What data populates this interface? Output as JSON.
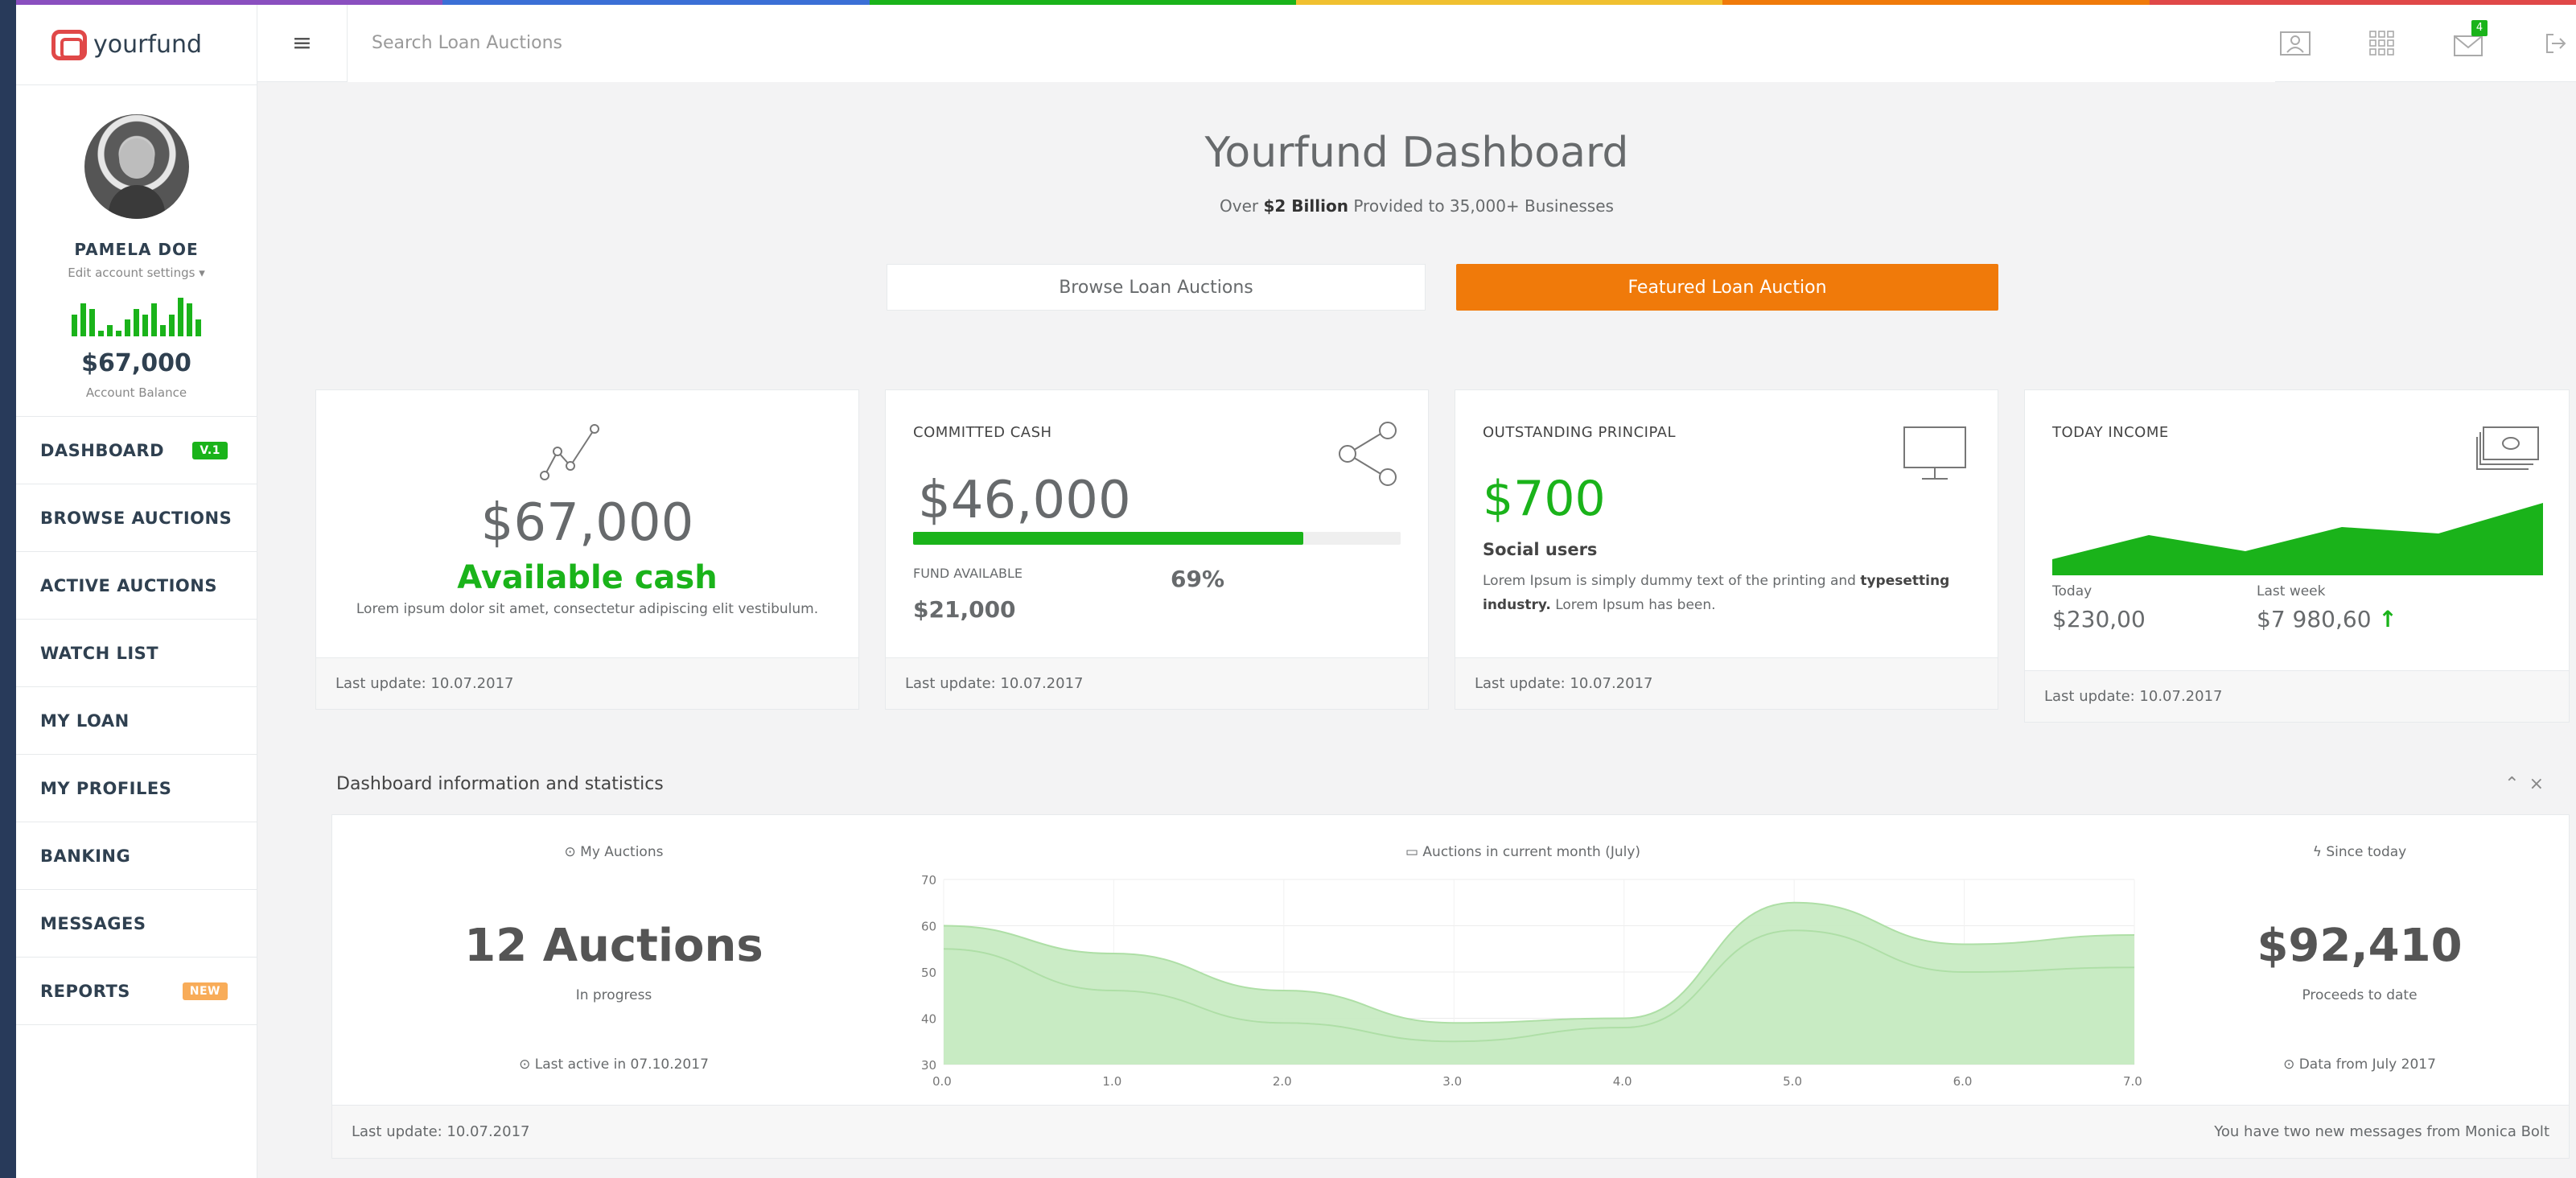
{
  "colors": {
    "accent_green": "#1ab31a",
    "orange": "#f07a0a",
    "navy": "#2f4050",
    "rainbow": [
      "#8a4fbf",
      "#3b6fd6",
      "#1ab31a",
      "#f0c030",
      "#f07a0a",
      "#e04848"
    ]
  },
  "logo": {
    "text": "yourfund"
  },
  "topbar": {
    "search_placeholder": "Search Loan Auctions",
    "mail_count": "4"
  },
  "profile": {
    "name": "PAMELA DOE",
    "settings": "Edit account settings ▾",
    "balance": "$67,000",
    "balance_label": "Account Balance",
    "spark": [
      4,
      6,
      5,
      1,
      2,
      1,
      3,
      5,
      4,
      6,
      2,
      4,
      7,
      6,
      3
    ]
  },
  "nav": {
    "dashboard": "DASHBOARD",
    "dashboard_badge": "V.1",
    "browse": "BROWSE AUCTIONS",
    "active": "ACTIVE AUCTIONS",
    "watch": "WATCH LIST",
    "loan": "MY LOAN",
    "profiles": "MY PROFILES",
    "banking": "BANKING",
    "messages": "MESSAGES",
    "reports": "REPORTS",
    "reports_badge": "NEW"
  },
  "hero": {
    "title": "Yourfund Dashboard",
    "sub_pre": "Over ",
    "sub_bold": "$2 Billion",
    "sub_post": " Provided to 35,000+ Businesses",
    "browse_btn": "Browse Loan Auctions",
    "featured_btn": "Featured Loan Auction"
  },
  "cards": {
    "available": {
      "value": "$67,000",
      "label": "Available cash",
      "desc": "Lorem ipsum dolor sit amet, consectetur adipiscing elit vestibulum.",
      "foot": "Last update: 10.07.2017"
    },
    "committed": {
      "title": "COMMITTED CASH",
      "value": "$46,000",
      "progress_pct": 0.8,
      "fund_label": "FUND AVAILABLE",
      "percent": "69%",
      "fund_amount": "$21,000",
      "foot": "Last update: 10.07.2017"
    },
    "outstanding": {
      "title": "OUTSTANDING PRINCIPAL",
      "value": "$700",
      "sub": "Social users",
      "desc_pre": "Lorem Ipsum is simply dummy text of the printing and ",
      "desc_bold1": "typesetting industry.",
      "desc_post": " Lorem Ipsum has been.",
      "foot": "Last update: 10.07.2017"
    },
    "income": {
      "title": "TODAY INCOME",
      "today_label": "Today",
      "today_value": "$230,00",
      "week_label": "Last week",
      "week_value": "$7 980,60",
      "trend_icon": "arrow-up-icon",
      "foot": "Last update: 10.07.2017"
    }
  },
  "stats": {
    "title": "Dashboard information and statistics",
    "left_head": "⊙ My Auctions",
    "left_big": "12 Auctions",
    "left_sub": "In progress",
    "left_foot": "⊙ Last active in 07.10.2017",
    "chart_head": "▭ Auctions in current month (July)",
    "right_head": "ϟ Since today",
    "right_big": "$92,410",
    "right_sub": "Proceeds to date",
    "right_foot": "⊙ Data from July 2017",
    "foot_left": "Last update: 10.07.2017",
    "foot_right": "You have two new messages from Monica Bolt"
  },
  "chart_data": {
    "type": "area",
    "title": "Auctions in current month (July)",
    "x": [
      0,
      1,
      2,
      3,
      4,
      5,
      6,
      7
    ],
    "series": [
      {
        "values": [
          55,
          46,
          39,
          35,
          38,
          59,
          50,
          51
        ]
      },
      {
        "values": [
          60,
          54,
          46,
          39,
          40,
          65,
          56,
          58
        ]
      }
    ],
    "xlim": [
      0,
      7
    ],
    "ylim": [
      30,
      70
    ],
    "xticks": [
      "0.0",
      "1.0",
      "2.0",
      "3.0",
      "4.0",
      "5.0",
      "6.0",
      "7.0"
    ],
    "yticks": [
      "30",
      "40",
      "50",
      "60",
      "70"
    ],
    "grid": true
  }
}
